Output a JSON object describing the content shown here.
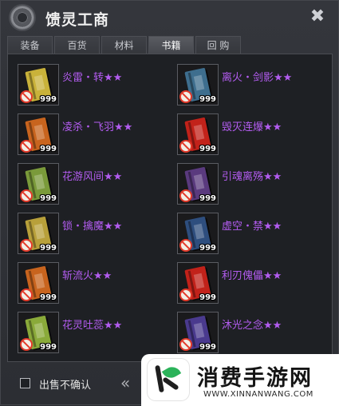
{
  "window": {
    "title": "馈灵工商"
  },
  "tabs": [
    {
      "label": "装备",
      "active": false
    },
    {
      "label": "百货",
      "active": false
    },
    {
      "label": "材料",
      "active": false
    },
    {
      "label": "书籍",
      "active": true
    },
    {
      "label": "回 购",
      "active": false
    }
  ],
  "items": [
    {
      "name": "炎雷・转★★",
      "qty": "999",
      "icon": "yellow-book-icon",
      "color": "#c9b23a"
    },
    {
      "name": "离火・剑影★★",
      "qty": "999",
      "icon": "blue-book-icon",
      "color": "#3e6e8e"
    },
    {
      "name": "凌杀・飞羽★★",
      "qty": "999",
      "icon": "orange-book-icon",
      "color": "#c8641e"
    },
    {
      "name": "毁灭连爆★★",
      "qty": "999",
      "icon": "red-book-icon",
      "color": "#c2221a"
    },
    {
      "name": "花游风间★★",
      "qty": "999",
      "icon": "green-book-icon",
      "color": "#7a9a3a"
    },
    {
      "name": "引魂离殇★★",
      "qty": "999",
      "icon": "purple-book-icon",
      "color": "#5a3a7e"
    },
    {
      "name": "锁・擒魔★★",
      "qty": "999",
      "icon": "yellow-book-icon",
      "color": "#b8a03a"
    },
    {
      "name": "虚空・禁★★",
      "qty": "999",
      "icon": "blue-book-icon",
      "color": "#2e4e7e"
    },
    {
      "name": "斩流火★★",
      "qty": "999",
      "icon": "orange-book-icon",
      "color": "#c8641e"
    },
    {
      "name": "利刃傀儡★★",
      "qty": "999",
      "icon": "red-book-icon",
      "color": "#c2221a"
    },
    {
      "name": "花灵吐蕊★★",
      "qty": "999",
      "icon": "green-book-icon",
      "color": "#8aaa3a"
    },
    {
      "name": "沐光之念★★",
      "qty": "999",
      "icon": "purple-book-icon",
      "color": "#4a3a8e"
    }
  ],
  "footer": {
    "checkbox_label": "出售不确认",
    "prev_icon": "double-chevron-left-icon"
  },
  "watermark": {
    "title": "消费手游网",
    "url": "WWW.XINNANWANG.COM"
  },
  "colors": {
    "item_name": "#b35cf0",
    "ban": "#e23a2a"
  }
}
